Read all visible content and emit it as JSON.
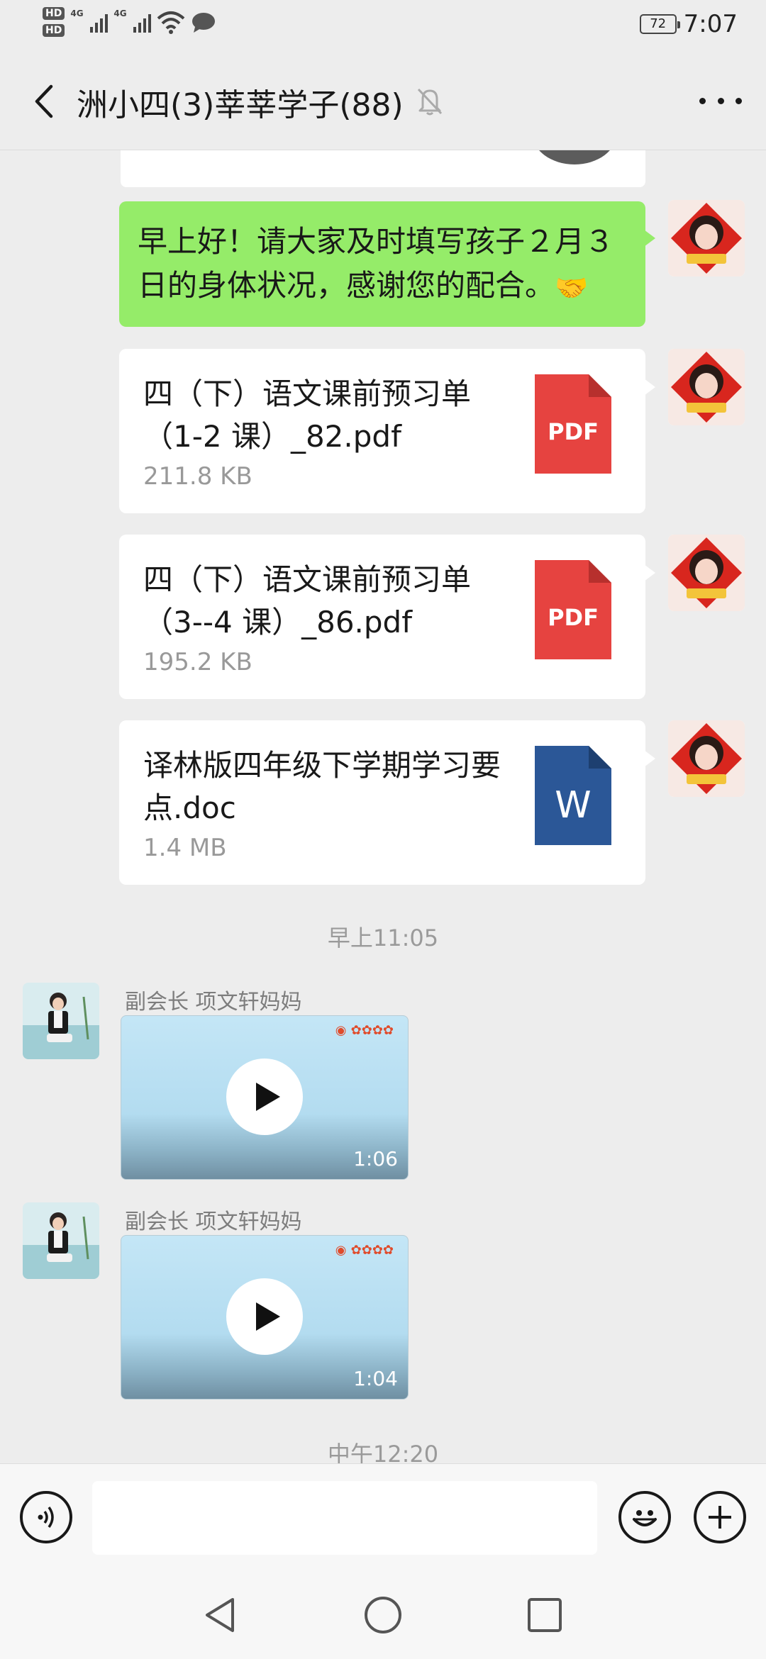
{
  "status_bar": {
    "hd1": "HD",
    "hd2": "HD",
    "net1": "4G",
    "net2": "4G",
    "battery": "72",
    "time": "7:07"
  },
  "header": {
    "title": "洲小四(3)莘莘学子(88)",
    "icons": {
      "back": "chevron-left-icon",
      "mute": "bell-off-icon",
      "more": "more-dots-icon"
    }
  },
  "messages": {
    "greeting": {
      "text": "早上好！请大家及时填写孩子２月３日的身体状况，感谢您的配合。",
      "emoji": "🤝"
    },
    "files": [
      {
        "name": "四（下）语文课前预习单（1-2 课）_82.pdf",
        "size": "211.8 KB",
        "type_label": "PDF",
        "color": "#e64340"
      },
      {
        "name": "四（下）语文课前预习单（3--4 课）_86.pdf",
        "size": "195.2 KB",
        "type_label": "PDF",
        "color": "#e64340"
      },
      {
        "name": "译林版四年级下学期学习要点.doc",
        "size": "1.4 MB",
        "type_label": "W",
        "color": "#2b5797"
      }
    ],
    "time1": "早上11:05",
    "videos": [
      {
        "sender": "副会长 项文轩妈妈",
        "duration": "1:06"
      },
      {
        "sender": "副会长 项文轩妈妈",
        "duration": "1:04"
      }
    ],
    "time2": "中午12:20"
  },
  "input_bar": {
    "value": "",
    "icons": {
      "voice": "voice-icon",
      "emoji": "smiley-icon",
      "plus": "plus-circle-icon"
    }
  },
  "nav_bar": {
    "icons": {
      "back": "nav-back-icon",
      "home": "nav-home-icon",
      "recents": "nav-recents-icon"
    }
  },
  "colors": {
    "self_bubble": "#95ec69",
    "background": "#ededed",
    "pdf": "#e64340",
    "word": "#2b5797"
  }
}
